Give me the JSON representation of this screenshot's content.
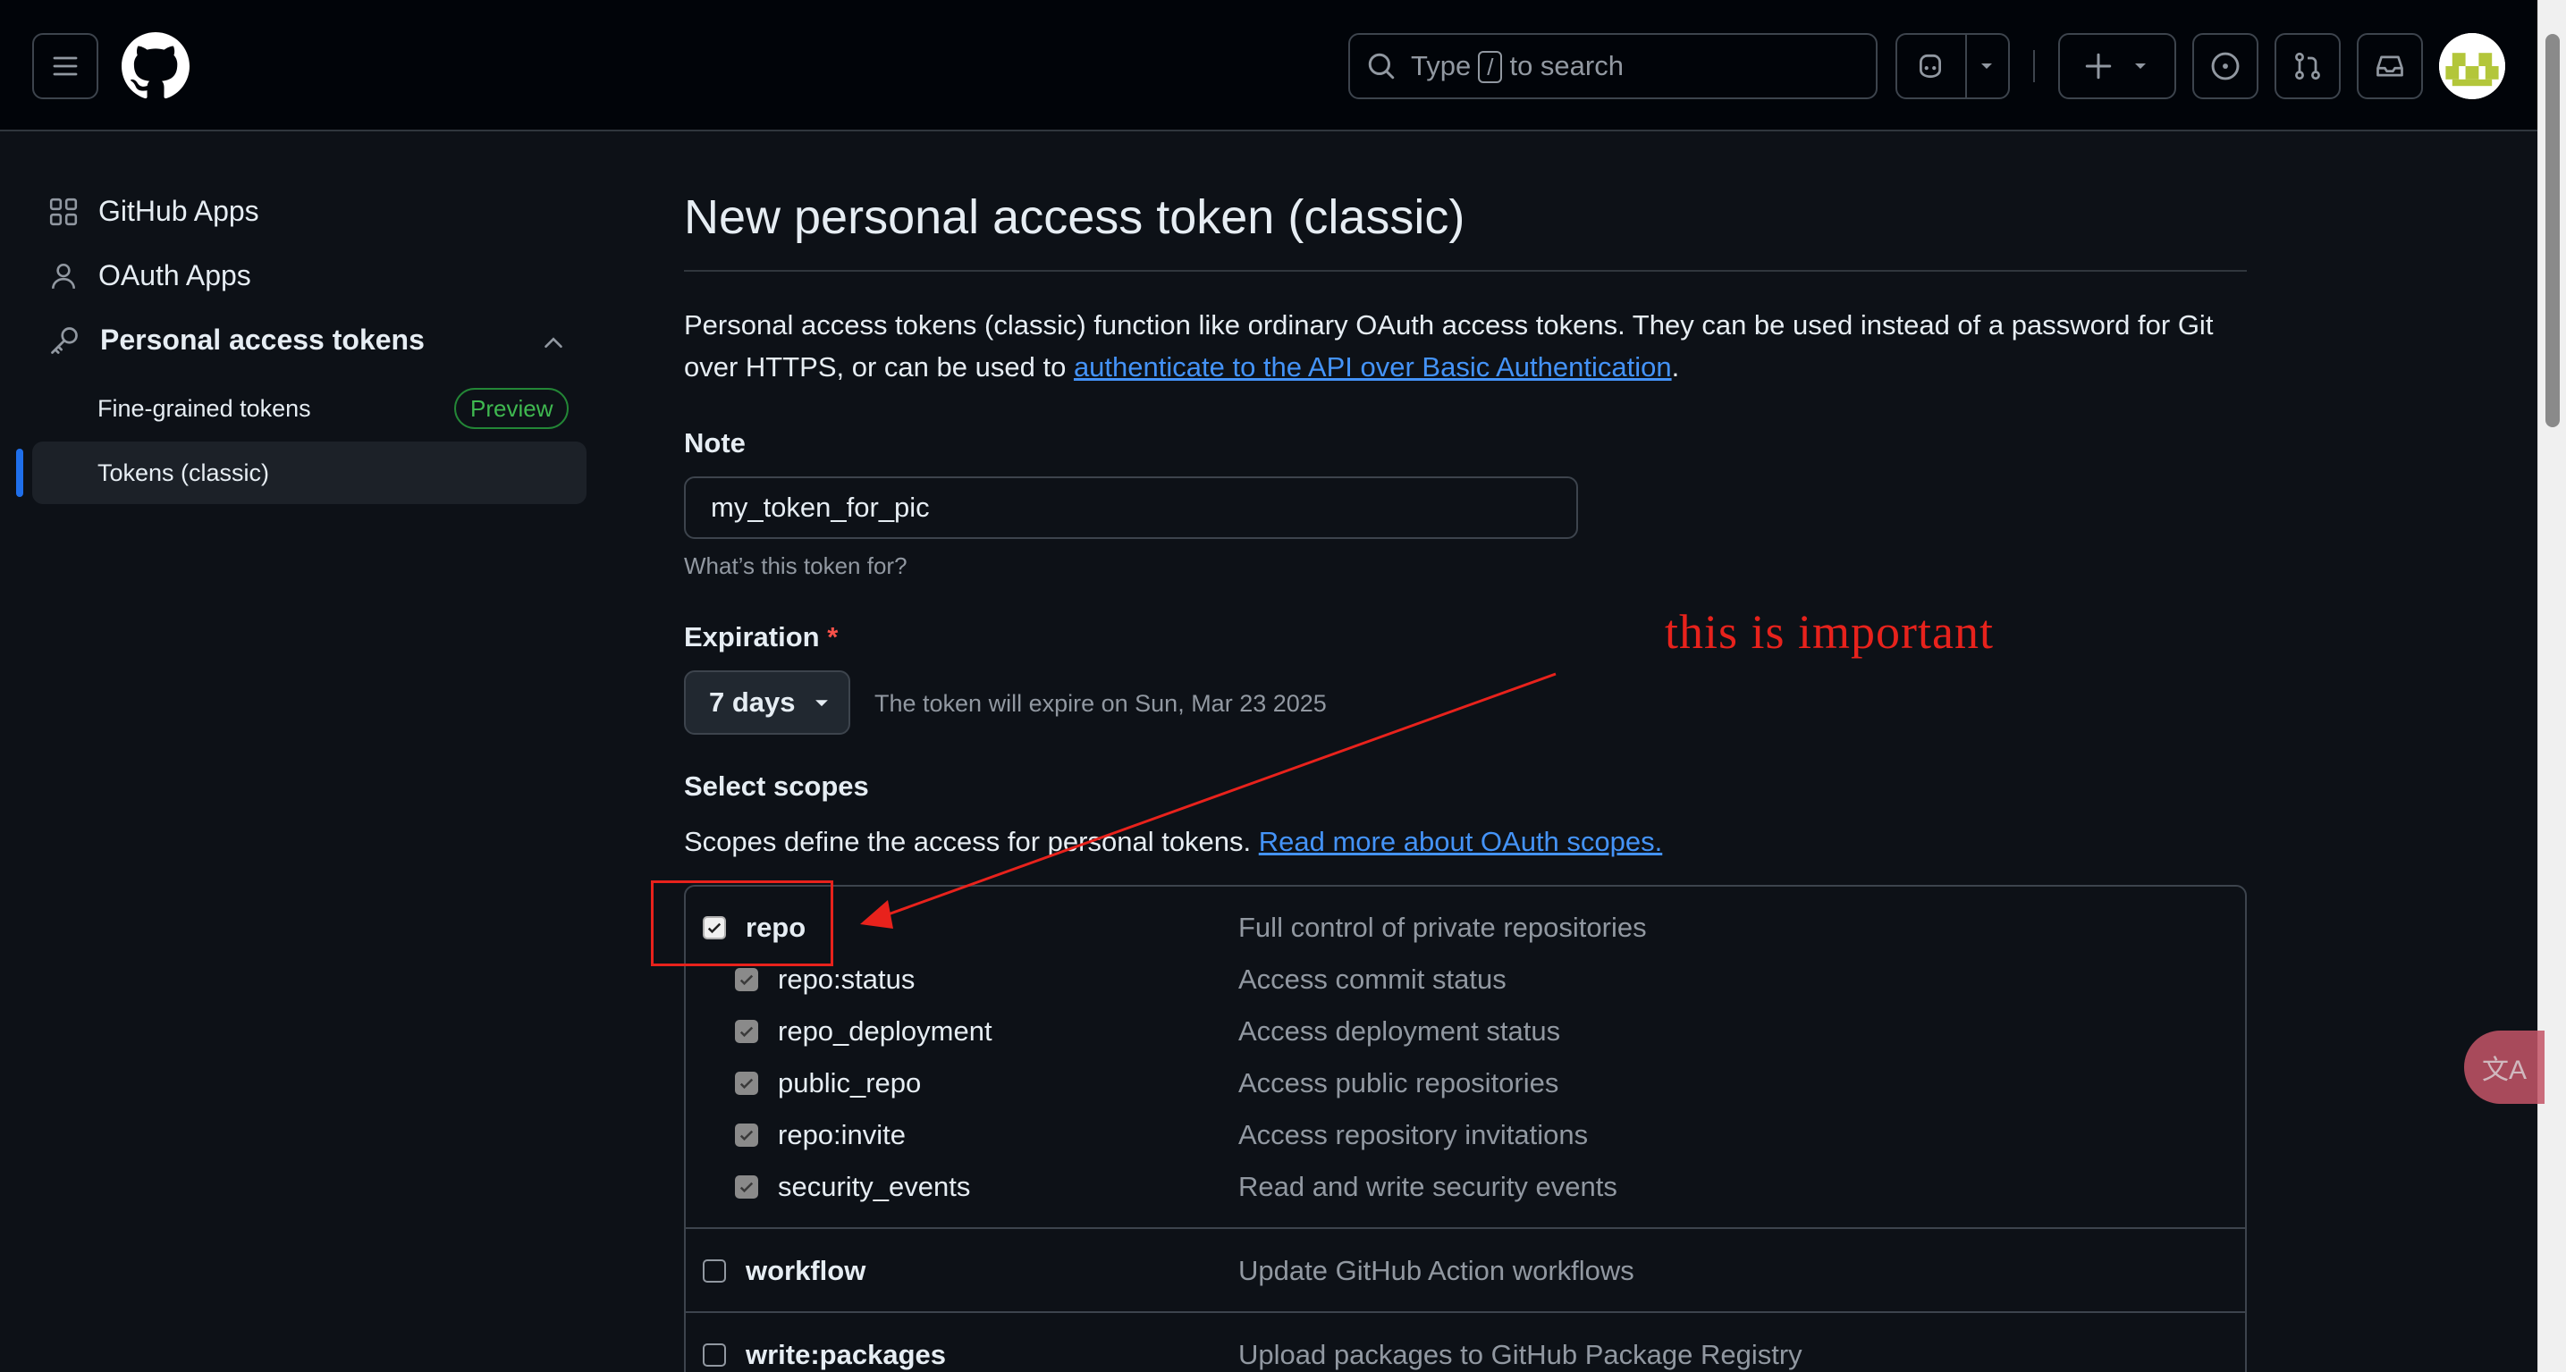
{
  "header": {
    "search_prefix": "Type",
    "search_key": "/",
    "search_suffix": "to search"
  },
  "sidebar": {
    "items": [
      {
        "label": "GitHub Apps",
        "icon": "apps-grid-icon"
      },
      {
        "label": "OAuth Apps",
        "icon": "person-icon"
      },
      {
        "label": "Personal access tokens",
        "icon": "key-icon"
      }
    ],
    "sub_items": [
      {
        "label": "Fine-grained tokens",
        "badge": "Preview"
      },
      {
        "label": "Tokens (classic)",
        "active": true
      }
    ]
  },
  "main": {
    "title": "New personal access token (classic)",
    "description_text": "Personal access tokens (classic) function like ordinary OAuth access tokens. They can be used instead of a password for Git over HTTPS, or can be used to ",
    "description_link": "authenticate to the API over Basic Authentication",
    "description_end": ".",
    "note_label": "Note",
    "note_value": "my_token_for_pic",
    "note_hint": "What’s this token for?",
    "expiration_label": "Expiration",
    "expiration_required": "*",
    "expiration_value": "7 days",
    "expiration_note": "The token will expire on Sun, Mar 23 2025",
    "scopes_label": "Select scopes",
    "scopes_desc": "Scopes define the access for personal tokens. ",
    "scopes_link": "Read more about OAuth scopes.",
    "scopes": [
      {
        "name": "repo",
        "desc": "Full control of private repositories",
        "checked": true,
        "parent": true
      },
      {
        "name": "repo:status",
        "desc": "Access commit status",
        "checked": true,
        "parent": false
      },
      {
        "name": "repo_deployment",
        "desc": "Access deployment status",
        "checked": true,
        "parent": false
      },
      {
        "name": "public_repo",
        "desc": "Access public repositories",
        "checked": true,
        "parent": false
      },
      {
        "name": "repo:invite",
        "desc": "Access repository invitations",
        "checked": true,
        "parent": false
      },
      {
        "name": "security_events",
        "desc": "Read and write security events",
        "checked": true,
        "parent": false
      },
      {
        "name": "workflow",
        "desc": "Update GitHub Action workflows",
        "checked": false,
        "parent": true
      },
      {
        "name": "write:packages",
        "desc": "Upload packages to GitHub Package Registry",
        "checked": false,
        "parent": true
      }
    ]
  },
  "annotation": {
    "text": "this is important",
    "color": "#e8221c"
  },
  "colors": {
    "background": "#0d1117",
    "header": "#010409",
    "link": "#4493f8",
    "accent": "#1f6feb",
    "preview": "#3fb950"
  },
  "translate_icon_text": "文A"
}
